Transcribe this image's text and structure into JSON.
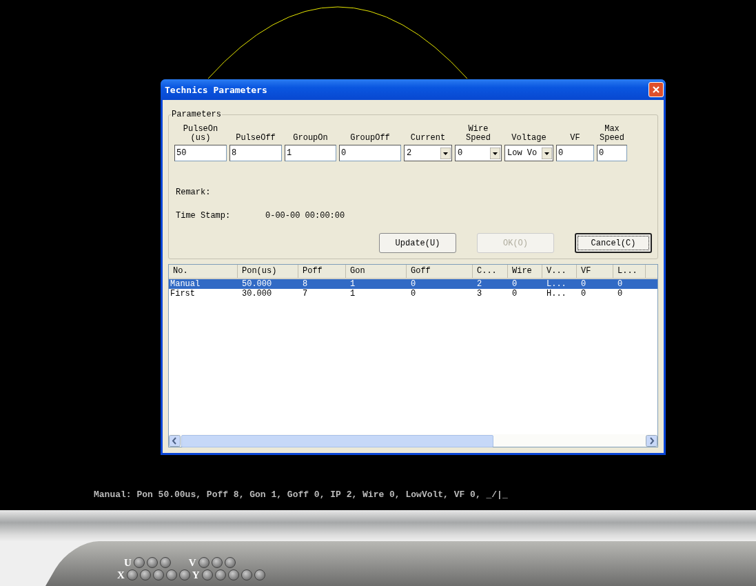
{
  "window": {
    "title": "Technics Parameters"
  },
  "parameters": {
    "legend": "Parameters",
    "fields": [
      {
        "kind": "text",
        "label": "PulseOn\n(us)",
        "value": "50"
      },
      {
        "kind": "text",
        "label": "PulseOff",
        "value": "8"
      },
      {
        "kind": "text",
        "label": "GroupOn",
        "value": "1"
      },
      {
        "kind": "text",
        "label": "GroupOff",
        "value": "0"
      },
      {
        "kind": "combo",
        "label": "Current",
        "value": "2"
      },
      {
        "kind": "combo",
        "label": "Wire\nSpeed",
        "value": "0"
      },
      {
        "kind": "combo",
        "label": "Voltage",
        "value": "Low Vo"
      },
      {
        "kind": "text",
        "label": "VF",
        "value": "0"
      },
      {
        "kind": "text",
        "label": "Max\nSpeed",
        "value": "0"
      }
    ],
    "remark_label": "Remark:",
    "time_stamp_label": "Time Stamp:",
    "time_stamp": "0-00-00 00:00:00",
    "buttons": [
      {
        "label": "Update(U)",
        "disabled": false,
        "default": false
      },
      {
        "label": "OK(O)",
        "disabled": true,
        "default": false
      },
      {
        "label": "Cancel(C)",
        "disabled": false,
        "default": true
      }
    ]
  },
  "table": {
    "columns": [
      "No.",
      "Pon(us)",
      "Poff",
      "Gon",
      "Goff",
      "C...",
      "Wire",
      "V...",
      "VF",
      "L..."
    ],
    "rows": [
      {
        "selected": true,
        "cells": [
          "Manual",
          "50.000",
          "8",
          "1",
          "0",
          "2",
          "0",
          "L...",
          "0",
          "0"
        ]
      },
      {
        "selected": false,
        "cells": [
          "First",
          "30.000",
          "7",
          "1",
          "0",
          "3",
          "0",
          "H...",
          "0",
          "0"
        ]
      }
    ]
  },
  "status_line": "Manual: Pon 50.00us, Poff 8, Gon 1, Goff 0, IP 2, Wire 0, LowVolt, VF 0, _/|_",
  "indicators": [
    {
      "label": "U",
      "lights": [
        {
          "on": false
        },
        {
          "on": false
        },
        {
          "on": false
        }
      ]
    },
    {
      "label": "V",
      "lights": [
        {
          "on": false
        },
        {
          "on": false
        },
        {
          "on": false
        }
      ]
    },
    {
      "label": "X",
      "lights": [
        {
          "on": false
        },
        {
          "on": false
        },
        {
          "on": false
        },
        {
          "on": false
        },
        {
          "on": false
        }
      ]
    },
    {
      "label": "Y",
      "lights": [
        {
          "on": false
        },
        {
          "on": false
        },
        {
          "on": false
        },
        {
          "on": false
        },
        {
          "on": false
        }
      ]
    }
  ]
}
